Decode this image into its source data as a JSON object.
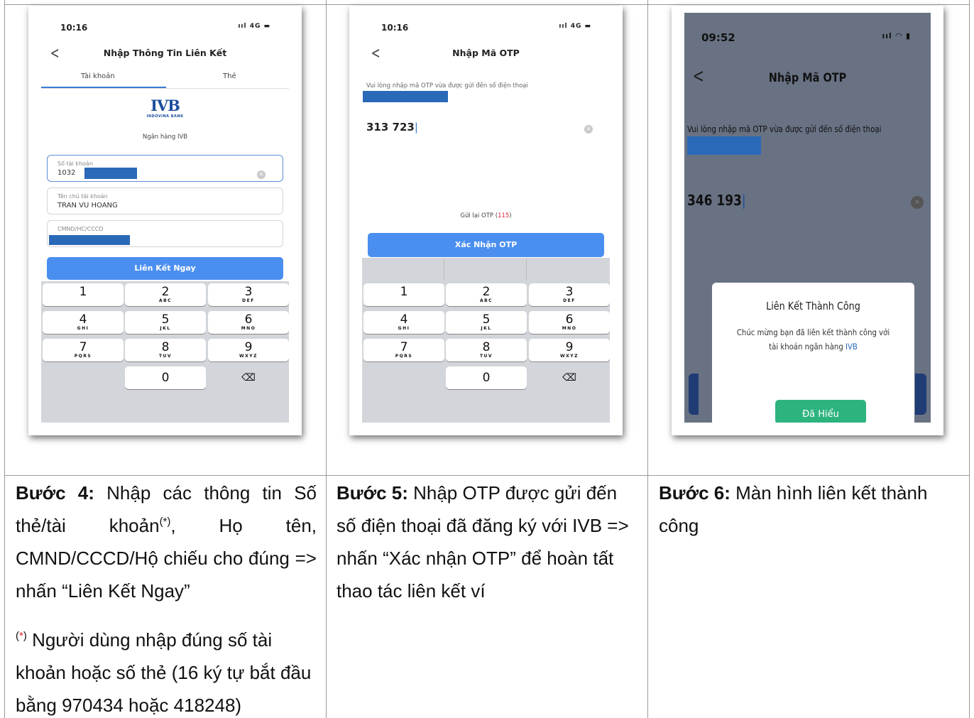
{
  "steps": [
    {
      "status_time": "10:16",
      "status_signal": "ııl 4G ▬",
      "nav_title": "Nhập Thông Tin Liên Kết",
      "tab_account": "Tài khoản",
      "tab_card": "Thẻ",
      "bank_logo": "IVB",
      "bank_logo_sub": "INDOVINA BANK",
      "bank_name": "Ngân hàng IVB",
      "account_label": "Số tài khoản",
      "account_value": "1032",
      "holder_label": "Tên chủ tài khoản",
      "holder_value": "TRAN VU HOANG",
      "id_label": "CMND/HC/CCCD",
      "button": "Liên Kết Ngay"
    },
    {
      "status_time": "10:16",
      "status_signal": "ııl 4G ▬",
      "nav_title": "Nhập Mã OTP",
      "otp_message": "Vui lòng nhập mã OTP vừa được gửi đến số điện thoại",
      "otp_value": "313 723",
      "resend_label": "Gửi lại OTP (",
      "resend_count": "115",
      "resend_close": ")",
      "button": "Xác Nhận OTP"
    },
    {
      "status_time": "09:52",
      "status_signal": "ııl ◠ ▮",
      "nav_title": "Nhập Mã OTP",
      "otp_message": "Vui lòng nhập mã OTP vừa được gửi đến số điện thoại",
      "otp_value": "346 193",
      "dialog_title": "Liên Kết Thành Công",
      "dialog_message": "Chúc mừng bạn đã liên kết thành công với tài khoản ngân hàng ",
      "dialog_bank": "IVB",
      "dialog_button": "Đã Hiểu"
    }
  ],
  "keypad": [
    {
      "digit": "1",
      "letters": ""
    },
    {
      "digit": "2",
      "letters": "ABC"
    },
    {
      "digit": "3",
      "letters": "DEF"
    },
    {
      "digit": "4",
      "letters": "GHI"
    },
    {
      "digit": "5",
      "letters": "JKL"
    },
    {
      "digit": "6",
      "letters": "MNO"
    },
    {
      "digit": "7",
      "letters": "PQRS"
    },
    {
      "digit": "8",
      "letters": "TUV"
    },
    {
      "digit": "9",
      "letters": "WXYZ"
    },
    {
      "digit": "0",
      "letters": ""
    },
    {
      "digit": "⌫",
      "letters": ""
    }
  ],
  "captions": {
    "step4_label": "Bước 4:",
    "step4_text_a": " Nhập các thông tin Số thẻ/tài khoản",
    "step4_sup": "(*)",
    "step4_text_b": ", Họ tên, CMND/CCCD/Hộ chiếu cho đúng => nhấn “Liên Kết Ngay”",
    "note_open": "(",
    "note_star": "*",
    "note_close": ")",
    "note_text": " Người dùng nhập đúng số tài khoản hoặc số thẻ (16 ký tự bắt đầu bằng 970434 hoặc 418248)",
    "step5_label": "Bước 5:",
    "step5_text": " Nhập OTP được gửi đến số điện thoại đã đăng ký với IVB => nhấn “Xác nhận OTP” để hoàn tất thao tác liên kết ví",
    "step6_label": "Bước 6:",
    "step6_text": " Màn hình liên kết thành công"
  },
  "colors": {
    "primary_blue": "#4a8ff0",
    "redaction": "#2a69b8",
    "success_green": "#2db37e",
    "countdown_red": "#dd2233"
  }
}
